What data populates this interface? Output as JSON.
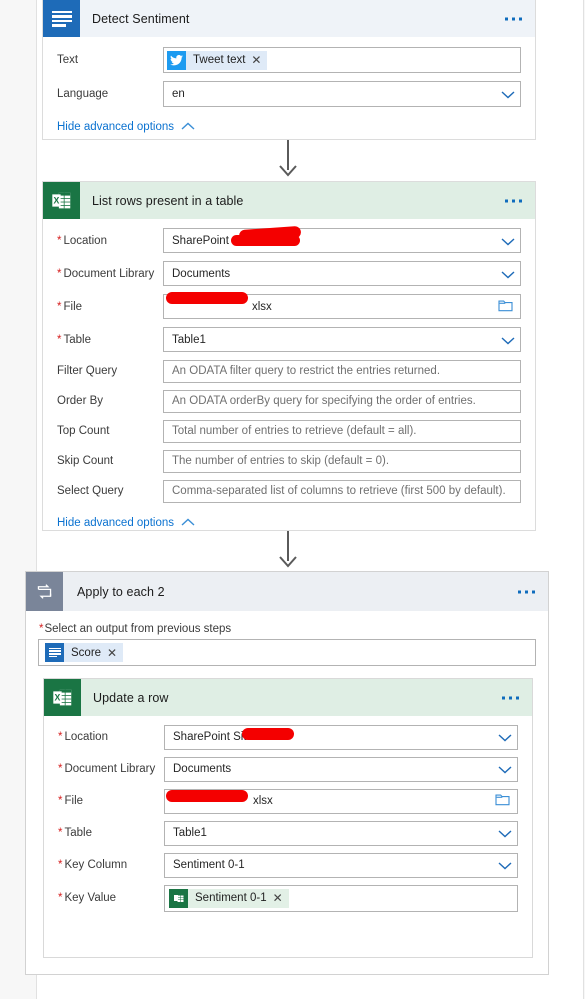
{
  "flow": {
    "steps": [
      {
        "id": "detect-sentiment",
        "title": "Detect Sentiment",
        "icon": "text-analytics-icon",
        "accent": "#1e6bb8",
        "header_bg": "#eff3f8",
        "fields": [
          {
            "label": "Text",
            "required": false,
            "kind": "token",
            "token": {
              "text": "Tweet text",
              "icon": "twitter-icon"
            }
          },
          {
            "label": "Language",
            "required": false,
            "kind": "select",
            "value": "en"
          }
        ],
        "advanced_link": "Hide advanced options",
        "menu": "more-options"
      },
      {
        "id": "list-rows-present-in-a-table",
        "title": "List rows present in a table",
        "icon": "excel-icon",
        "accent": "#1a7544",
        "header_bg": "#dfeee4",
        "fields": [
          {
            "label": "Location",
            "required": true,
            "kind": "select",
            "value": "SharePoint Site",
            "redacted": true
          },
          {
            "label": "Document Library",
            "required": true,
            "kind": "select",
            "value": "Documents"
          },
          {
            "label": "File",
            "required": true,
            "kind": "file",
            "value": "xlsx",
            "redacted": true
          },
          {
            "label": "Table",
            "required": true,
            "kind": "select",
            "value": "Table1"
          },
          {
            "label": "Filter Query",
            "required": false,
            "kind": "text",
            "placeholder": "An ODATA filter query to restrict the entries returned."
          },
          {
            "label": "Order By",
            "required": false,
            "kind": "text",
            "placeholder": "An ODATA orderBy query for specifying the order of entries."
          },
          {
            "label": "Top Count",
            "required": false,
            "kind": "text",
            "placeholder": "Total number of entries to retrieve (default = all)."
          },
          {
            "label": "Skip Count",
            "required": false,
            "kind": "text",
            "placeholder": "The number of entries to skip (default = 0)."
          },
          {
            "label": "Select Query",
            "required": false,
            "kind": "text",
            "placeholder": "Comma-separated list of columns to retrieve (first 500 by default)."
          }
        ],
        "advanced_link": "Hide advanced options",
        "menu": "more-options"
      }
    ],
    "loop": {
      "id": "apply-to-each-2",
      "title": "Apply to each 2",
      "icon": "loop-icon",
      "accent": "#7a8599",
      "header_bg": "#eceff3",
      "output_label": "Select an output from previous steps",
      "output_required": true,
      "output_token": {
        "text": "Score",
        "icon": "text-analytics-icon"
      },
      "menu": "more-options",
      "child": {
        "id": "update-a-row",
        "title": "Update a row",
        "icon": "excel-icon",
        "accent": "#1a7544",
        "header_bg": "#dfeee4",
        "menu": "more-options",
        "fields": [
          {
            "label": "Location",
            "required": true,
            "kind": "select",
            "value": "SharePoint Site",
            "redacted": true
          },
          {
            "label": "Document Library",
            "required": true,
            "kind": "select",
            "value": "Documents"
          },
          {
            "label": "File",
            "required": true,
            "kind": "file",
            "value": "xlsx",
            "redacted": true
          },
          {
            "label": "Table",
            "required": true,
            "kind": "select",
            "value": "Table1"
          },
          {
            "label": "Key Column",
            "required": true,
            "kind": "select",
            "value": "Sentiment 0-1"
          },
          {
            "label": "Key Value",
            "required": true,
            "kind": "token",
            "token": {
              "text": "Sentiment 0-1",
              "icon": "excel-icon"
            }
          }
        ]
      }
    },
    "connectors": [
      {
        "name": "connector-detect-to-list"
      },
      {
        "name": "connector-list-to-loop"
      }
    ]
  },
  "colors": {
    "redaction": "#f40000",
    "link": "#0b72d0",
    "required": "#d62121",
    "excel_green": "#1a7544",
    "analytics_blue": "#1e6bb8",
    "loop_slate": "#7a8599"
  }
}
